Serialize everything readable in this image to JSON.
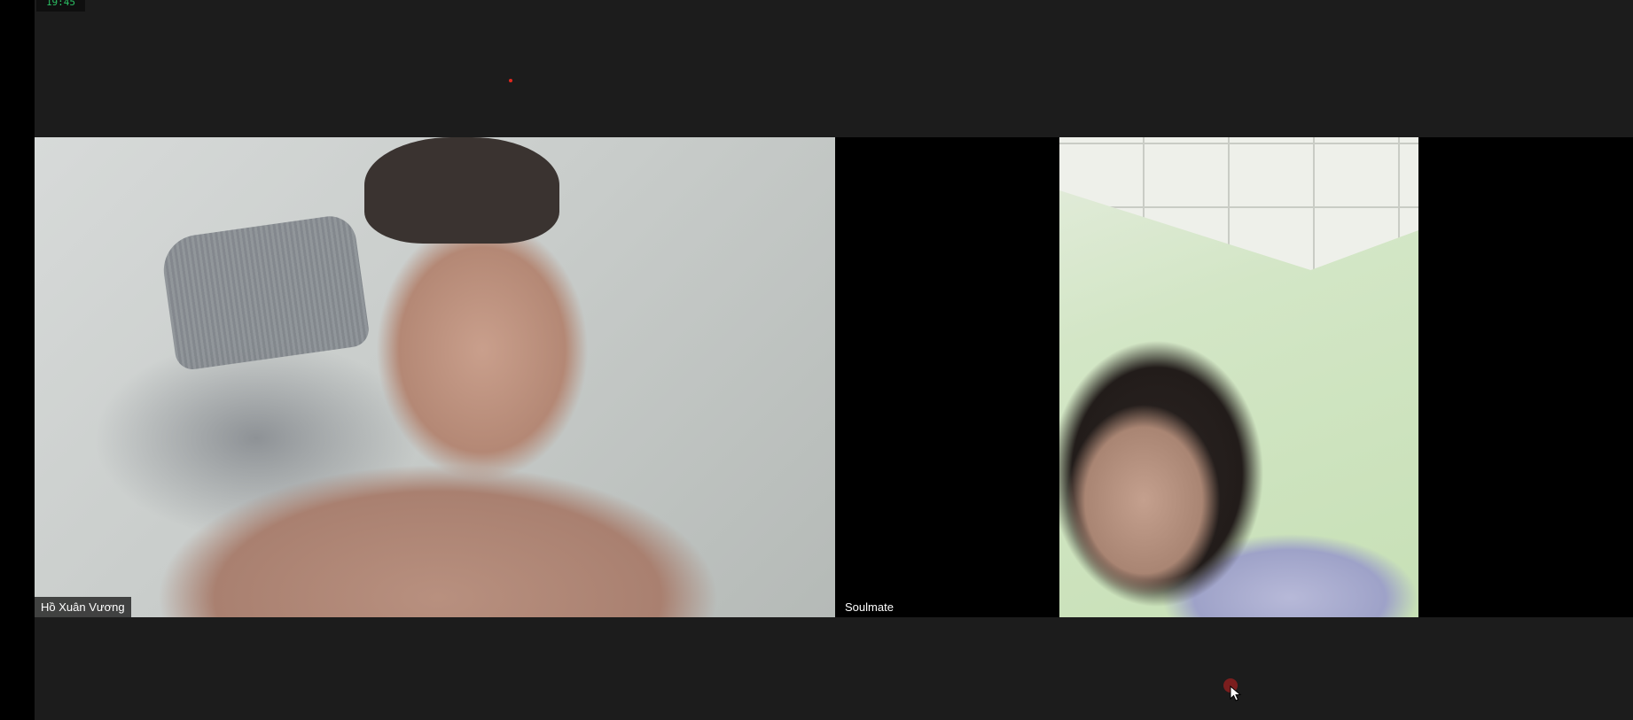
{
  "meeting": {
    "timer": "19:45",
    "recording_indicator_color": "#e0281e"
  },
  "participants": [
    {
      "name": "Hồ Xuân Vương",
      "video": "on"
    },
    {
      "name": "Soulmate",
      "video": "on"
    }
  ],
  "colors": {
    "background": "#1c1c1c",
    "tile_background": "#000000",
    "timer_text": "#2bbf63",
    "name_text": "#ffffff"
  },
  "icons": {
    "cursor": "mouse-pointer-icon",
    "recording": "recording-dot-icon"
  }
}
